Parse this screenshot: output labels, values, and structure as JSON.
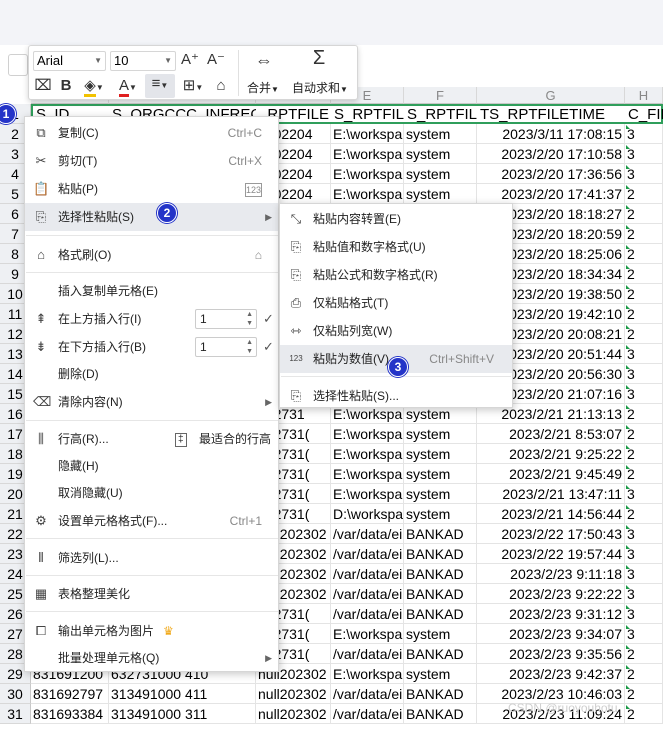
{
  "toolbar": {
    "font_name": "Arial",
    "font_size": "10",
    "grow_font": "A⁺",
    "shrink_font": "A⁻",
    "bold": "B",
    "merge_label": "合并",
    "autosum_label": "自动求和"
  },
  "columns": [
    {
      "letter": "C",
      "header": "S_ID"
    },
    {
      "letter": "D",
      "header": "S_ORGCCC_INFRECS"
    },
    {
      "letter": "",
      "header": "_RPTFILE"
    },
    {
      "letter": "E",
      "header": "S_RPTFILE"
    },
    {
      "letter": "F",
      "header": "S_RPTFILE"
    },
    {
      "letter": "G",
      "header": "TS_RPTFILETIME"
    },
    {
      "letter": "H",
      "header": "C_FIL"
    }
  ],
  "rows": [
    {
      "n": "1"
    },
    {
      "n": "2",
      "c3": "2302204",
      "c4": "E:\\workspa",
      "c5": "system",
      "c6": "2023/3/11 17:08:15",
      "c7": "3"
    },
    {
      "n": "3",
      "c3": "2302204",
      "c4": "E:\\workspa",
      "c5": "system",
      "c6": "2023/2/20 17:10:58",
      "c7": "3"
    },
    {
      "n": "4",
      "c3": "2302204",
      "c4": "E:\\workspa",
      "c5": "system",
      "c6": "2023/2/20 17:36:56",
      "c7": "3"
    },
    {
      "n": "5",
      "c3": "2302204",
      "c4": "E:\\workspa",
      "c5": "system",
      "c6": "2023/2/20 17:41:37",
      "c7": "2"
    },
    {
      "n": "6",
      "c6": "2023/2/20 18:18:27",
      "c7": "2"
    },
    {
      "n": "7",
      "c6": "2023/2/20 18:20:59",
      "c7": "2"
    },
    {
      "n": "8",
      "c6": "2023/2/20 18:25:06",
      "c7": "2"
    },
    {
      "n": "9",
      "c6": "2023/2/20 18:34:34",
      "c7": "2"
    },
    {
      "n": "10",
      "c6": "2023/2/20 19:38:50",
      "c7": "2"
    },
    {
      "n": "11",
      "c6": "2023/2/20 19:42:10",
      "c7": "2"
    },
    {
      "n": "12",
      "c6": "2023/2/20 20:08:21",
      "c7": "2"
    },
    {
      "n": "13",
      "c6": "2023/2/20 20:51:44",
      "c7": "3"
    },
    {
      "n": "14",
      "c6": "2023/2/20 20:56:30",
      "c7": "3"
    },
    {
      "n": "15",
      "c6": "2023/2/20 21:07:16",
      "c7": "3"
    },
    {
      "n": "16",
      "c3": "632731",
      "c4": "E:\\workspa",
      "c5": "system",
      "c6": "2023/2/21 21:13:13",
      "c7": "2"
    },
    {
      "n": "17",
      "c3": "632731(",
      "c4": "E:\\workspa",
      "c5": "system",
      "c6": "2023/2/21 8:53:07",
      "c7": "2"
    },
    {
      "n": "18",
      "c3": "632731(",
      "c4": "E:\\workspa",
      "c5": "system",
      "c6": "2023/2/21 9:25:22",
      "c7": "2"
    },
    {
      "n": "19",
      "c3": "632731(",
      "c4": "E:\\workspa",
      "c5": "system",
      "c6": "2023/2/21 9:45:49",
      "c7": "2"
    },
    {
      "n": "20",
      "c3": "632731(",
      "c4": "E:\\workspa",
      "c5": "system",
      "c6": "2023/2/21 13:47:11",
      "c7": "3"
    },
    {
      "n": "21",
      "c3": "632731(",
      "c4": "D:\\workspa",
      "c5": "system",
      "c6": "2023/2/21 14:56:44",
      "c7": "2"
    },
    {
      "n": "22",
      "c3": "null202302",
      "c4": "/var/data/ei",
      "c5": "BANKAD",
      "c6": "2023/2/22 17:50:43",
      "c7": "3"
    },
    {
      "n": "23",
      "c3": "null202302",
      "c4": "/var/data/ei",
      "c5": "BANKAD",
      "c6": "2023/2/22 19:57:44",
      "c7": "3"
    },
    {
      "n": "24",
      "c3": "null202302",
      "c4": "/var/data/ei",
      "c5": "BANKAD",
      "c6": "2023/2/23 9:11:18",
      "c7": "3"
    },
    {
      "n": "25",
      "c3": "null202302",
      "c4": "/var/data/ei",
      "c5": "BANKAD",
      "c6": "2023/2/23 9:22:22",
      "c7": "3"
    },
    {
      "n": "26",
      "c3": "632731(",
      "c4": "/var/data/ei",
      "c5": "BANKAD",
      "c6": "2023/2/23 9:31:12",
      "c7": "3"
    },
    {
      "n": "27",
      "c3": "632731(",
      "c4": "E:\\workspa",
      "c5": "system",
      "c6": "2023/2/23 9:34:07",
      "c7": "3"
    },
    {
      "n": "28",
      "c3": "632731(",
      "c4": "/var/data/ei",
      "c5": "BANKAD",
      "c6": "2023/2/23 9:35:56",
      "c7": "2"
    },
    {
      "n": "29",
      "c1": "831691200",
      "c2": "632731000 410",
      "c3": "null202302",
      "c4": "E:\\workspa",
      "c5": "system",
      "c6": "2023/2/23 9:42:37",
      "c7": "2"
    },
    {
      "n": "30",
      "c1": "831692797",
      "c2": "313491000 411",
      "c3": "null202302",
      "c4": "/var/data/ei",
      "c5": "BANKAD",
      "c6": "2023/2/23 10:46:03",
      "c7": "2"
    },
    {
      "n": "31",
      "c1": "831693384",
      "c2": "313491000 311",
      "c3": "null202302",
      "c4": "/var/data/ei",
      "c5": "BANKAD",
      "c6": "2023/2/23 11:09:24",
      "c7": "2"
    }
  ],
  "context_menu": {
    "copy": {
      "label": "复制(C)",
      "shortcut": "Ctrl+C"
    },
    "cut": {
      "label": "剪切(T)",
      "shortcut": "Ctrl+X"
    },
    "paste": {
      "label": "粘贴(P)"
    },
    "paste_special": {
      "label": "选择性粘贴(S)"
    },
    "format_painter": {
      "label": "格式刷(O)"
    },
    "insert_copied": {
      "label": "插入复制单元格(E)"
    },
    "insert_above": {
      "label": "在上方插入行(I)",
      "value": "1"
    },
    "insert_below": {
      "label": "在下方插入行(B)",
      "value": "1"
    },
    "delete": {
      "label": "删除(D)"
    },
    "clear": {
      "label": "清除内容(N)"
    },
    "row_height": {
      "label": "行高(R)...",
      "extra": "最适合的行高"
    },
    "hide": {
      "label": "隐藏(H)"
    },
    "unhide": {
      "label": "取消隐藏(U)"
    },
    "format_cells": {
      "label": "设置单元格格式(F)...",
      "shortcut": "Ctrl+1"
    },
    "filter": {
      "label": "筛选列(L)..."
    },
    "beautify": {
      "label": "表格整理美化"
    },
    "export_image": {
      "label": "输出单元格为图片"
    },
    "batch": {
      "label": "批量处理单元格(Q)"
    }
  },
  "submenu": {
    "transpose": {
      "label": "粘贴内容转置(E)"
    },
    "values_numbers": {
      "label": "粘贴值和数字格式(U)"
    },
    "formulas_numbers": {
      "label": "粘贴公式和数字格式(R)"
    },
    "formats_only": {
      "label": "仅粘贴格式(T)"
    },
    "col_width": {
      "label": "仅粘贴列宽(W)"
    },
    "as_values": {
      "label": "粘贴为数值(V)",
      "shortcut": "Ctrl+Shift+V"
    },
    "paste_special": {
      "label": "选择性粘贴(S)..."
    }
  },
  "badges": [
    "1",
    "2",
    "3"
  ],
  "watermark": "CSDN @ruoyouhotu"
}
